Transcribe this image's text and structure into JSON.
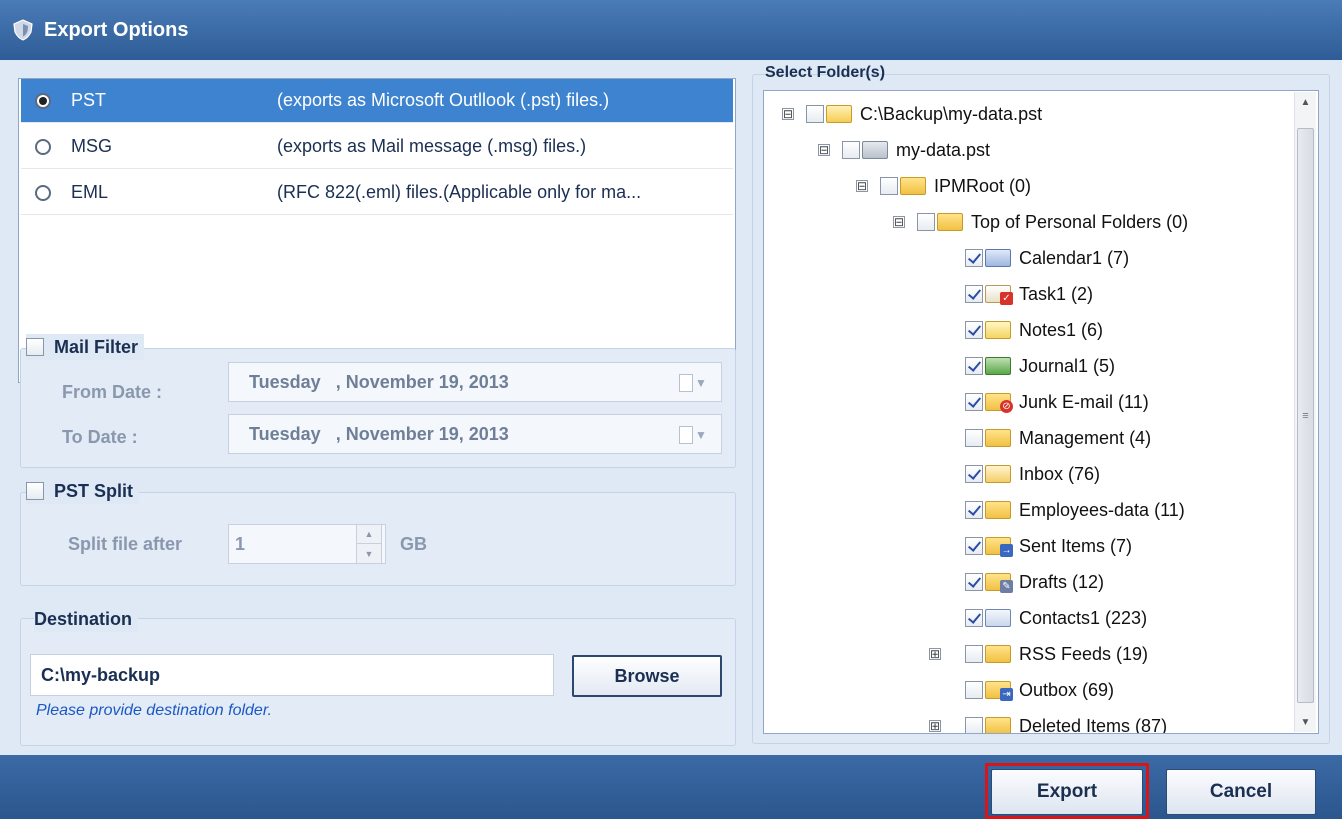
{
  "window": {
    "title": "Export Options"
  },
  "export_types": [
    {
      "code": "PST",
      "description": "(exports as Microsoft Outllook (.pst) files.)",
      "selected": true
    },
    {
      "code": "MSG",
      "description": "(exports as Mail message (.msg) files.)",
      "selected": false
    },
    {
      "code": "EML",
      "description": "(RFC 822(.eml) files.(Applicable only for ma...",
      "selected": false
    }
  ],
  "mail_filter": {
    "label": "Mail Filter",
    "checked": false,
    "from_label": "From Date :",
    "from_value": "Tuesday   , November 19, 2013",
    "to_label": "To Date :",
    "to_value": "Tuesday   , November 19, 2013"
  },
  "pst_split": {
    "label": "PST Split",
    "checked": false,
    "split_label": "Split file after",
    "value": "1",
    "unit": "GB"
  },
  "destination": {
    "label": "Destination",
    "path": "C:\\my-backup",
    "browse_label": "Browse",
    "hint": "Please provide destination folder."
  },
  "folders": {
    "label": "Select Folder(s)",
    "items": [
      {
        "label": "C:\\Backup\\my-data.pst",
        "expander": "⊟",
        "checked": false,
        "icon": "open-folder-icon"
      },
      {
        "label": "my-data.pst",
        "expander": "⊟",
        "checked": false,
        "icon": "pst-file-icon"
      },
      {
        "label": "IPMRoot (0)",
        "expander": "⊟",
        "checked": false,
        "icon": "folder-icon"
      },
      {
        "label": "Top of Personal Folders (0)",
        "expander": "⊟",
        "checked": false,
        "icon": "folder-icon"
      },
      {
        "label": "Calendar1 (7)",
        "expander": "",
        "checked": true,
        "icon": "calendar-icon"
      },
      {
        "label": "Task1 (2)",
        "expander": "",
        "checked": true,
        "icon": "task-icon"
      },
      {
        "label": "Notes1 (6)",
        "expander": "",
        "checked": true,
        "icon": "notes-icon"
      },
      {
        "label": "Journal1 (5)",
        "expander": "",
        "checked": true,
        "icon": "journal-icon"
      },
      {
        "label": "Junk E-mail (11)",
        "expander": "",
        "checked": true,
        "icon": "junk-folder-icon"
      },
      {
        "label": "Management (4)",
        "expander": "",
        "checked": false,
        "icon": "folder-icon"
      },
      {
        "label": "Inbox (76)",
        "expander": "",
        "checked": true,
        "icon": "inbox-icon"
      },
      {
        "label": "Employees-data (11)",
        "expander": "",
        "checked": true,
        "icon": "folder-icon"
      },
      {
        "label": "Sent Items (7)",
        "expander": "",
        "checked": true,
        "icon": "sent-items-icon"
      },
      {
        "label": "Drafts (12)",
        "expander": "",
        "checked": true,
        "icon": "drafts-icon"
      },
      {
        "label": "Contacts1 (223)",
        "expander": "",
        "checked": true,
        "icon": "contacts-icon"
      },
      {
        "label": "RSS Feeds (19)",
        "expander": "⊞",
        "checked": false,
        "icon": "folder-icon"
      },
      {
        "label": "Outbox (69)",
        "expander": "",
        "checked": false,
        "icon": "outbox-icon"
      },
      {
        "label": "Deleted Items (87)",
        "expander": "⊞",
        "checked": false,
        "icon": "deleted-items-icon"
      }
    ]
  },
  "footer": {
    "export_label": "Export",
    "cancel_label": "Cancel"
  },
  "colors": {
    "accent": "#3d83d0",
    "title_bar": "#2e5c96",
    "highlight": "#d7161b"
  }
}
